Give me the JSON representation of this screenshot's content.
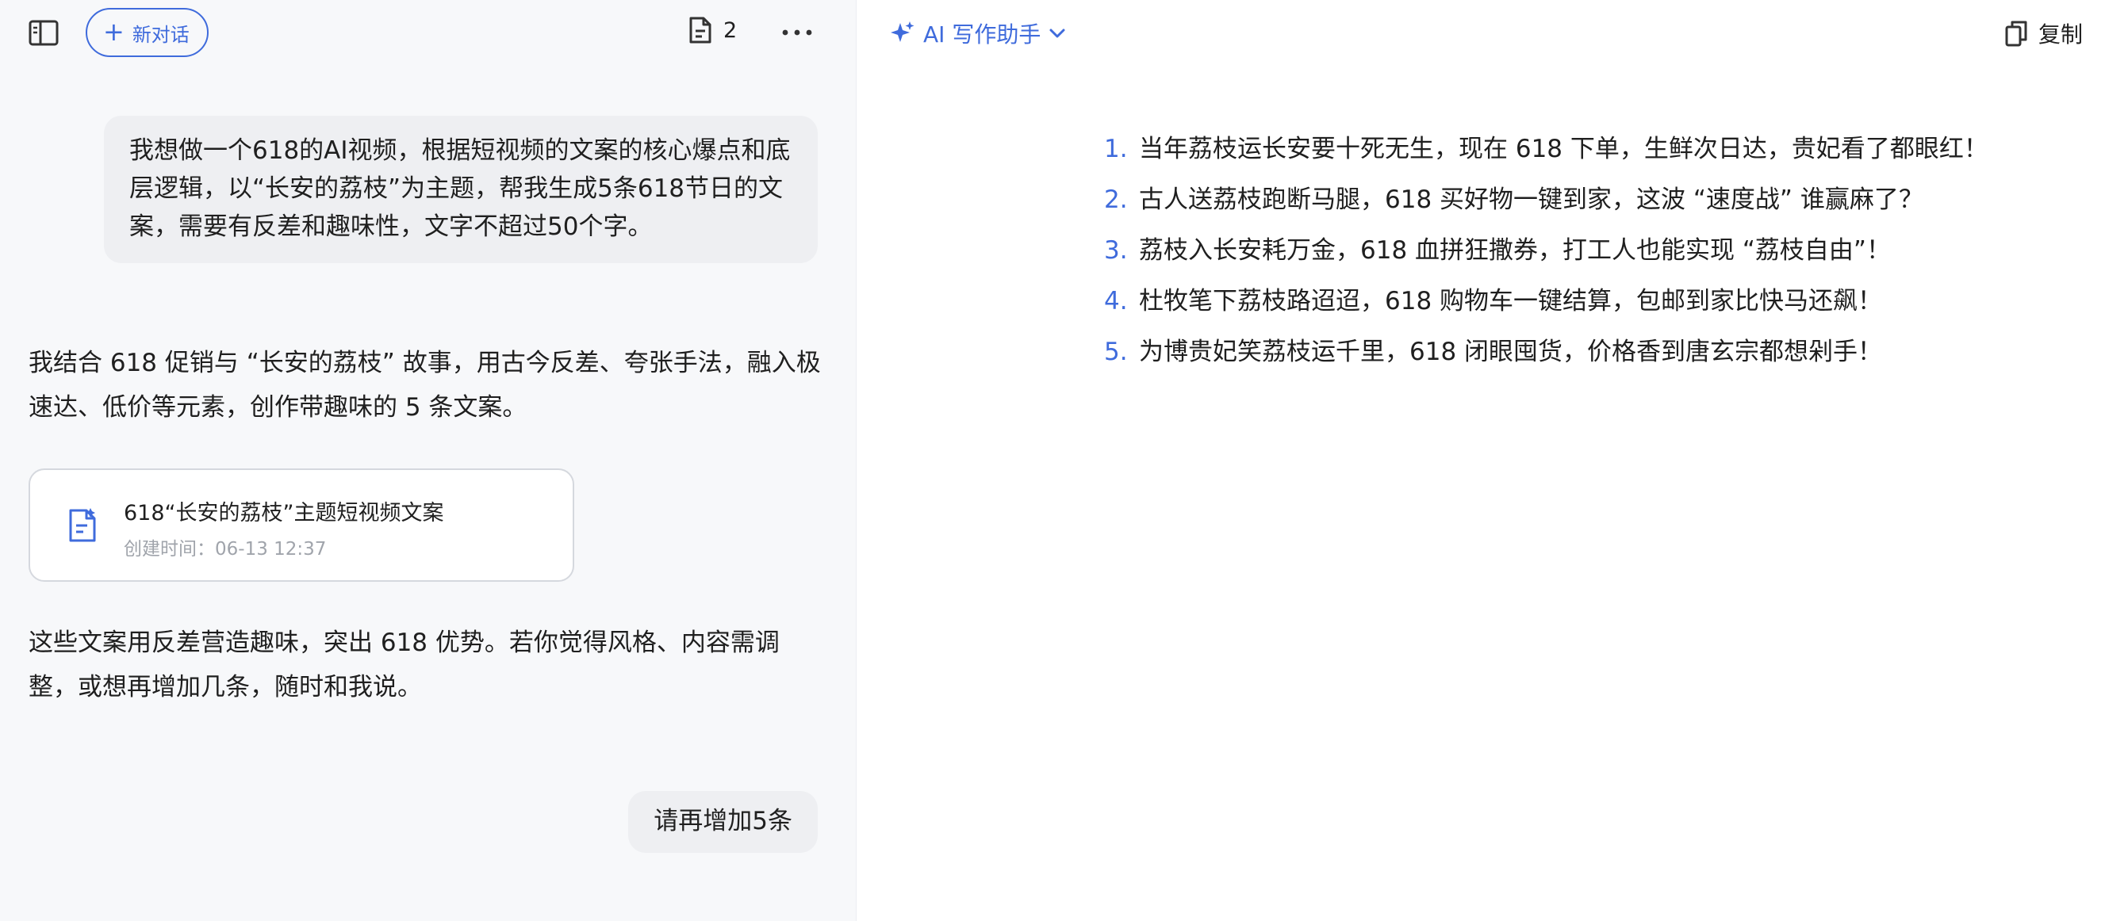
{
  "header": {
    "new_chat_label": "新对话",
    "doc_count": "2"
  },
  "conversation": {
    "user_message_1": "我想做一个618的AI视频，根据短视频的文案的核心爆点和底层逻辑，以“长安的荔枝”为主题，帮我生成5条618节日的文案，需要有反差和趣味性，文字不超过50个字。",
    "assistant_message_1": "我结合 618 促销与 “长安的荔枝” 故事，用古今反差、夸张手法，融入极速达、低价等元素，创作带趣味的 5 条文案。",
    "doc_card": {
      "title": "618“长安的荔枝”主题短视频文案",
      "time": "创建时间：06-13 12:37"
    },
    "assistant_message_2": "这些文案用反差营造趣味，突出 618 优势。若你觉得风格、内容需调整，或想再增加几条，随时和我说。",
    "user_message_2": "请再增加5条"
  },
  "writer_panel": {
    "title": "AI 写作助手",
    "copy_label": "复制",
    "items": [
      {
        "num": "1.",
        "text": "当年荔枝运长安要十死无生，现在 618 下单，生鲜次日达，贵妃看了都眼红！"
      },
      {
        "num": "2.",
        "text": "古人送荔枝跑断马腿，618 买好物一键到家，这波 “速度战” 谁赢麻了？"
      },
      {
        "num": "3.",
        "text": "荔枝入长安耗万金，618 血拼狂撒券，打工人也能实现 “荔枝自由”！"
      },
      {
        "num": "4.",
        "text": "杜牧笔下荔枝路迢迢，618 购物车一键结算，包邮到家比快马还飙！"
      },
      {
        "num": "5.",
        "text": "为博贵妃笑荔枝运千里，618 闭眼囤货，价格香到唐玄宗都想剁手！"
      }
    ]
  },
  "colors": {
    "accent": "#3f6bdc",
    "left_bg": "#f7f8fa",
    "bubble_bg": "#eeeff2"
  },
  "icons": {
    "sidebar_toggle": "sidebar-icon",
    "document": "document-icon",
    "more": "more-icon",
    "sparkle": "sparkle-icon",
    "chevron": "chevron-down-icon",
    "copy": "copy-icon",
    "plus": "plus-icon"
  }
}
